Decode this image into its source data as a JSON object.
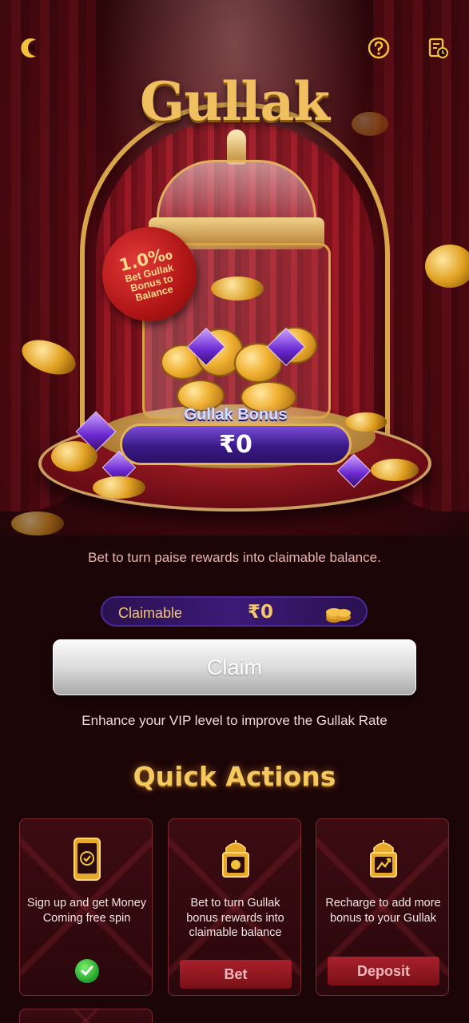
{
  "title": "Gullak",
  "tag": {
    "rate": "1.0‰",
    "text": "Bet Gullak Bonus to Balance"
  },
  "bonus": {
    "label": "Gullak Bonus",
    "amount": "₹0"
  },
  "hint_text": "Bet to turn paise rewards into claimable balance.",
  "claimable": {
    "label": "Claimable",
    "value": "₹0"
  },
  "claim_button": "Claim",
  "vip_hint": "Enhance your VIP level to improve the Gullak Rate",
  "quick_actions": {
    "title": "Quick Actions",
    "cards": [
      {
        "text": "Sign up and get Money Coming free spin",
        "icon": "phone-check-icon",
        "status": "completed"
      },
      {
        "text": "Bet to turn Gullak bonus rewards into claimable balance",
        "icon": "gullak-bet-icon",
        "button": "Bet"
      },
      {
        "text": "Recharge to add more bonus to your Gullak",
        "icon": "gullak-deposit-icon",
        "button": "Deposit"
      }
    ]
  },
  "colors": {
    "gold": "#f2c870",
    "card_button": "#a8202c",
    "plate": "#3a1a88"
  }
}
